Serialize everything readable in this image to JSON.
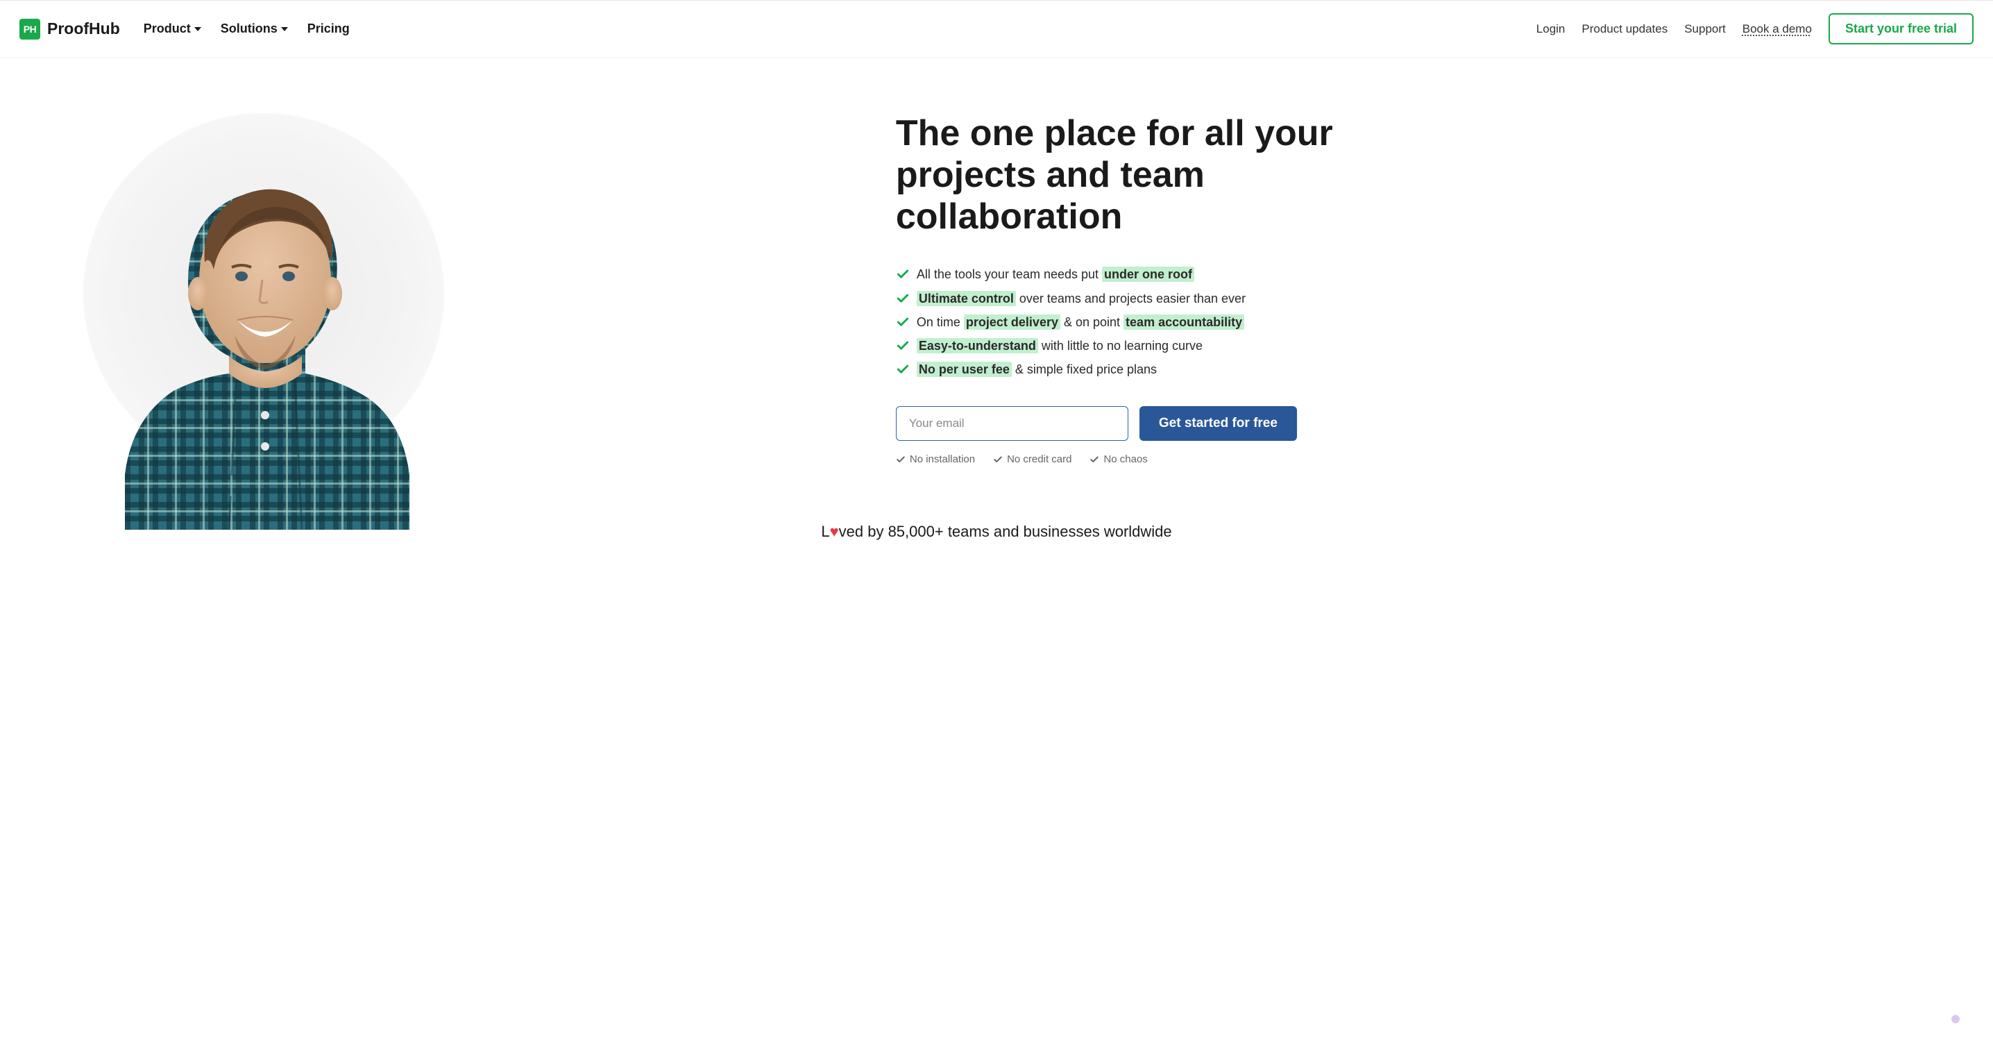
{
  "brand": {
    "logo_initials": "PH",
    "name": "ProofHub"
  },
  "nav": {
    "left": [
      {
        "label": "Product",
        "dropdown": true
      },
      {
        "label": "Solutions",
        "dropdown": true
      },
      {
        "label": "Pricing",
        "dropdown": false
      }
    ],
    "right": [
      {
        "label": "Login",
        "style": "plain"
      },
      {
        "label": "Product updates",
        "style": "plain"
      },
      {
        "label": "Support",
        "style": "plain"
      },
      {
        "label": "Book a demo",
        "style": "demo"
      }
    ],
    "cta": "Start your free trial"
  },
  "hero": {
    "title": "The one place for all your projects and team collaboration",
    "benefits": [
      {
        "parts": [
          {
            "t": "All the tools your team needs put "
          },
          {
            "t": "under one roof",
            "hl": true
          }
        ]
      },
      {
        "parts": [
          {
            "t": "Ultimate control",
            "hl": true
          },
          {
            "t": " over teams and projects easier than ever"
          }
        ]
      },
      {
        "parts": [
          {
            "t": "On time "
          },
          {
            "t": "project delivery",
            "hl": true
          },
          {
            "t": " & on point "
          },
          {
            "t": "team accountability",
            "hl": true
          }
        ]
      },
      {
        "parts": [
          {
            "t": "Easy-to-understand",
            "hl": true
          },
          {
            "t": " with little to no learning curve"
          }
        ]
      },
      {
        "parts": [
          {
            "t": "No per user fee",
            "hl": true
          },
          {
            "t": " & simple fixed price plans"
          }
        ]
      }
    ],
    "email_placeholder": "Your email",
    "get_started": "Get started for free",
    "sub_benefits": [
      "No installation",
      "No credit card",
      "No chaos"
    ]
  },
  "social_proof": {
    "prefix": "L",
    "suffix": "ved by 85,000+ teams and businesses worldwide"
  }
}
